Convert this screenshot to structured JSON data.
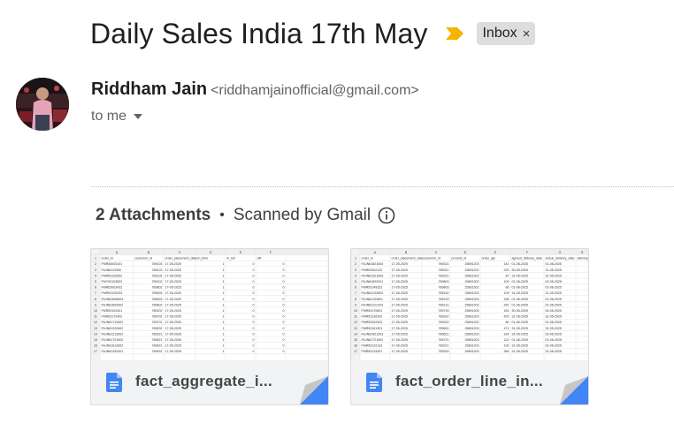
{
  "email": {
    "subject": "Daily Sales India 17th May",
    "label": "Inbox",
    "label_remove": "×",
    "sender_name": "Riddham Jain",
    "sender_email": "<riddhamjainofficial@gmail.com>",
    "recipient_line": "to me"
  },
  "attachments": {
    "count_label": "2 Attachments",
    "separator": "•",
    "scan_label": "Scanned by Gmail",
    "items": [
      {
        "file_name": "fact_aggregate_i...",
        "columns": [
          "A",
          "B",
          "C",
          "D",
          "E",
          "F"
        ],
        "headers": [
          "order_id",
          "customer_id",
          "order_placement_date",
          "on_time",
          "in_full",
          "otif"
        ],
        "rows": [
          [
            "FMR53003101",
            "789103",
            "17-05-2025",
            "1",
            "0",
            "0"
          ],
          [
            "FAJN611035ll",
            "789103",
            "17-05-2025",
            "1",
            "0",
            "0"
          ],
          [
            "FMR53102502",
            "789102",
            "17-05-2025",
            "1",
            "0",
            "0"
          ],
          [
            "FMY53103503",
            "789102",
            "17-05-2025",
            "1",
            "0",
            "0"
          ],
          [
            "FMR53003432",
            "789802",
            "17-05-2025",
            "1",
            "0",
            "0"
          ],
          [
            "FMR53102033",
            "789903",
            "17-05-2025",
            "1",
            "0",
            "0"
          ],
          [
            "FAJN61606603",
            "789603",
            "17-05-2025",
            "1",
            "0",
            "0"
          ],
          [
            "FAJN61602602",
            "789602",
            "17-05-2025",
            "1",
            "0",
            "0"
          ],
          [
            "FMR53102401",
            "789102",
            "17-05-2025",
            "1",
            "0",
            "0"
          ],
          [
            "FMR53172402",
            "789702",
            "17-05-2025",
            "1",
            "0",
            "0"
          ],
          [
            "FAJN61712602",
            "789702",
            "17-05-2025",
            "1",
            "0",
            "0"
          ],
          [
            "FAJN61202602",
            "789202",
            "17-05-2025",
            "1",
            "0",
            "0"
          ],
          [
            "FAJN61212602",
            "789221",
            "17-05-2025",
            "1",
            "0",
            "0"
          ],
          [
            "FAJN61721502",
            "789621",
            "17-05-2025",
            "1",
            "0",
            "0"
          ],
          [
            "FAJN61812602",
            "789621",
            "17-05-2025",
            "1",
            "0",
            "0"
          ],
          [
            "FAJN61432401",
            "789432",
            "17-05-2025",
            "1",
            "0",
            "0"
          ]
        ]
      },
      {
        "file_name": "fact_order_line_in...",
        "columns": [
          "A",
          "B",
          "C",
          "D",
          "E",
          "F",
          "G",
          "H"
        ],
        "headers": [
          "order_id",
          "order_placement_date",
          "customer_id",
          "product_id",
          "order_qty",
          "agreed_delivery_date",
          "actual_delivery_date",
          "delivery_qty"
        ],
        "rows": [
          [
            "FAJN61821603",
            "17-05-2025",
            "789321",
            "25891203",
            "141",
            "01-06-2025",
            "01-06-2025",
            ""
          ],
          [
            "FMR53302133",
            "17-05-2025",
            "789321",
            "25891202",
            "220",
            "30-05-2025",
            "31-05-2025",
            ""
          ],
          [
            "FAJN61321603",
            "17-05-2025",
            "789321",
            "25891302",
            "87",
            "31-05-2025",
            "31-05-2025",
            ""
          ],
          [
            "FAJN61802001",
            "17-05-2025",
            "789803",
            "25891302",
            "109",
            "01-06-2025",
            "02-06-2025",
            ""
          ],
          [
            "FMR53149333",
            "17-05-2025",
            "789803",
            "25891302",
            "86",
            "01-06-2025",
            "01-06-2025",
            ""
          ],
          [
            "FAJN61132603",
            "17-05-2025",
            "789132",
            "25891203",
            "109",
            "31-05-2025",
            "31-05-2025",
            ""
          ],
          [
            "FAJN61133601",
            "17-05-2025",
            "789133",
            "25891203",
            "336",
            "01-06-2025",
            "01-06-2025",
            ""
          ],
          [
            "FAJN61121203",
            "17-05-2025",
            "789121",
            "25891202",
            "287",
            "01-06-2025",
            "01-06-2025",
            ""
          ],
          [
            "FMR53170601",
            "17-05-2025",
            "789733",
            "25891203",
            "181",
            "30-05-2025",
            "30-05-2025",
            ""
          ],
          [
            "FMR53130202",
            "17-05-2025",
            "789202",
            "25891203",
            "429",
            "31-05-2025",
            "31-05-2025",
            ""
          ],
          [
            "FMR53202303",
            "17-05-2025",
            "789232",
            "25891202",
            "80",
            "01-06-2025",
            "01-06-2025",
            ""
          ],
          [
            "FMR53161301",
            "17-05-2025",
            "789601",
            "25891203",
            "471",
            "31-05-2025",
            "31-05-2025",
            ""
          ],
          [
            "FAJN61821203",
            "17-05-2025",
            "789621",
            "25891203",
            "324",
            "31-05-2025",
            "02-06-2025",
            ""
          ],
          [
            "FAJN61721502",
            "17-05-2025",
            "789721",
            "25891203",
            "122",
            "01-06-2025",
            "01-06-2025",
            ""
          ],
          [
            "FMR53122133",
            "17-05-2025",
            "789221",
            "25891203",
            "190",
            "31-05-2025",
            "02-06-2025",
            ""
          ],
          [
            "FMR53133301",
            "17-05-2025",
            "789333",
            "25891203",
            "384",
            "31-05-2025",
            "31-05-2025",
            ""
          ]
        ]
      }
    ]
  },
  "colors": {
    "importance_marker": "#f4b400",
    "doc_icon": "#4285f4",
    "fold_blue": "#4285f4",
    "fold_gray": "#c6c6c6"
  }
}
